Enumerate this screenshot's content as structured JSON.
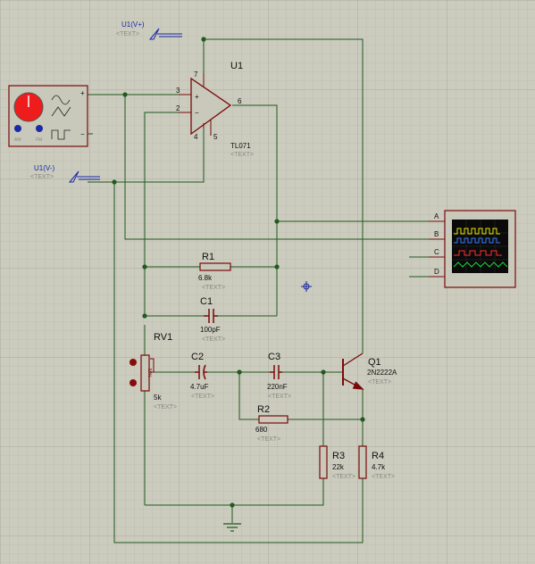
{
  "components": {
    "u1": {
      "ref": "U1",
      "value": "TL071",
      "text": "<TEXT>",
      "pins": {
        "in_plus": "3",
        "in_minus": "2",
        "out": "6",
        "vplus": "7",
        "vminus": "4",
        "offset": "5"
      },
      "plus_sign": "+",
      "minus_sign": "−"
    },
    "r1": {
      "ref": "R1",
      "value": "6.8k",
      "text": "<TEXT>"
    },
    "c1": {
      "ref": "C1",
      "value": "100pF",
      "text": "<TEXT>"
    },
    "rv1": {
      "ref": "RV1",
      "value": "5k",
      "text": "<TEXT>",
      "dial": "50%"
    },
    "c2": {
      "ref": "C2",
      "value": "4.7uF",
      "text": "<TEXT>"
    },
    "c3": {
      "ref": "C3",
      "value": "220nF",
      "text": "<TEXT>"
    },
    "q1": {
      "ref": "Q1",
      "value": "2N2222A",
      "text": "<TEXT>"
    },
    "r2": {
      "ref": "R2",
      "value": "680",
      "text": "<TEXT>"
    },
    "r3": {
      "ref": "R3",
      "value": "22k",
      "text": "<TEXT>"
    },
    "r4": {
      "ref": "R4",
      "value": "4.7k",
      "text": "<TEXT>"
    }
  },
  "ports": {
    "vplus": {
      "label": "U1(V+)",
      "text": "<TEXT>"
    },
    "vminus": {
      "label": "U1(V-)",
      "text": "<TEXT>"
    }
  },
  "generator": {
    "pin_plus": "+",
    "pin_minus": "−",
    "knob_left": "AM",
    "knob_right": "FM"
  },
  "oscilloscope": {
    "channels": [
      "A",
      "B",
      "C",
      "D"
    ],
    "trace_colors": [
      "#e8e800",
      "#3a7bff",
      "#ff3030",
      "#20d040"
    ]
  },
  "colors": {
    "wire": "#1f5a1f",
    "component": "#7a0a0a",
    "body_fill": "#c8c8bb",
    "port": "#1a2aa8"
  }
}
